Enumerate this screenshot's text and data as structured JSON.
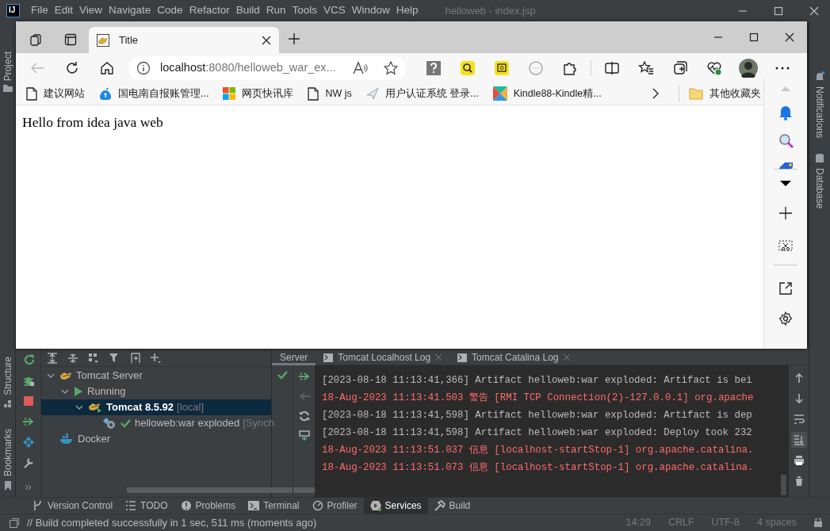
{
  "ide": {
    "logo_text": "IJ",
    "menu": [
      "File",
      "Edit",
      "View",
      "Navigate",
      "Code",
      "Refactor",
      "Build",
      "Run",
      "Tools",
      "VCS",
      "Window",
      "Help"
    ],
    "title": "helloweb - index.jsp",
    "left_stripe_top": [
      "Project"
    ],
    "left_stripe_bottom": [
      "Structure",
      "Bookmarks"
    ],
    "right_stripe": [
      "Notifications",
      "Database"
    ]
  },
  "browser": {
    "tabs": [
      {
        "title": "Title",
        "selected": true
      }
    ],
    "address": {
      "host": "localhost",
      "rest": ":8080/helloweb_war_ex..."
    },
    "bookmarks": [
      {
        "label": "建议网站",
        "kind": "page"
      },
      {
        "label": "国电南自报账管理...",
        "kind": "money"
      },
      {
        "label": "网页快讯库",
        "kind": "tiles"
      },
      {
        "label": "NW js",
        "kind": "page"
      },
      {
        "label": "用户认证系统 登录...",
        "kind": "plane"
      },
      {
        "label": "Kindle88-Kindle精...",
        "kind": "kindle"
      }
    ],
    "other_bookmarks": "其他收藏夹",
    "page_text": "Hello from idea java web"
  },
  "services": {
    "tree": [
      {
        "label": "Tomcat Server",
        "kind": "server",
        "expanded": true,
        "selected": false,
        "children": [
          {
            "label": "Running",
            "kind": "running",
            "expanded": true,
            "selected": false,
            "children": [
              {
                "label": "Tomcat 8.5.92",
                "suffix": "[local]",
                "kind": "tomcat",
                "expanded": true,
                "selected": true,
                "children": [
                  {
                    "label": "helloweb:war exploded",
                    "suffix": "[Synch",
                    "kind": "artifact",
                    "selected": false
                  }
                ]
              }
            ]
          }
        ]
      },
      {
        "label": "Docker",
        "kind": "docker",
        "selected": false
      }
    ],
    "log_tabs": [
      {
        "label": "Server",
        "selected": true,
        "closable": false
      },
      {
        "label": "Tomcat Localhost Log",
        "selected": false,
        "closable": true
      },
      {
        "label": "Tomcat Catalina Log",
        "selected": false,
        "closable": true
      }
    ],
    "log": [
      {
        "text": "[2023-08-18 11:13:41,366] Artifact helloweb:war exploded: Artifact is bei",
        "kind": "stdout"
      },
      {
        "text": "18-Aug-2023 11:13:41.503 警告 [RMI TCP Connection(2)-127.0.0.1] org.apache",
        "kind": "stderr"
      },
      {
        "text": "[2023-08-18 11:13:41,598] Artifact helloweb:war exploded: Artifact is dep",
        "kind": "stdout"
      },
      {
        "text": "[2023-08-18 11:13:41,598] Artifact helloweb:war exploded: Deploy took 232",
        "kind": "stdout"
      },
      {
        "text": "18-Aug-2023 11:13:51.037 信息 [localhost-startStop-1] org.apache.catalina.",
        "kind": "stderr"
      },
      {
        "text": "18-Aug-2023 11:13:51.073 信息 [localhost-startStop-1] org.apache.catalina.",
        "kind": "stderr"
      }
    ],
    "scroll_to_end": true
  },
  "tool_windows": [
    {
      "label": "Version Control",
      "kind": "vcs",
      "selected": false
    },
    {
      "label": "TODO",
      "kind": "todo",
      "selected": false
    },
    {
      "label": "Problems",
      "kind": "problems",
      "selected": false
    },
    {
      "label": "Terminal",
      "kind": "terminal",
      "selected": false
    },
    {
      "label": "Profiler",
      "kind": "profiler",
      "selected": false
    },
    {
      "label": "Services",
      "kind": "services",
      "selected": true
    },
    {
      "label": "Build",
      "kind": "build",
      "selected": false
    }
  ],
  "status_bar": {
    "message": "// Build completed successfully in 1 sec, 511 ms (moments ago)",
    "items": [
      "14:29",
      "CRLF",
      "UTF-8",
      "4 spaces"
    ]
  }
}
